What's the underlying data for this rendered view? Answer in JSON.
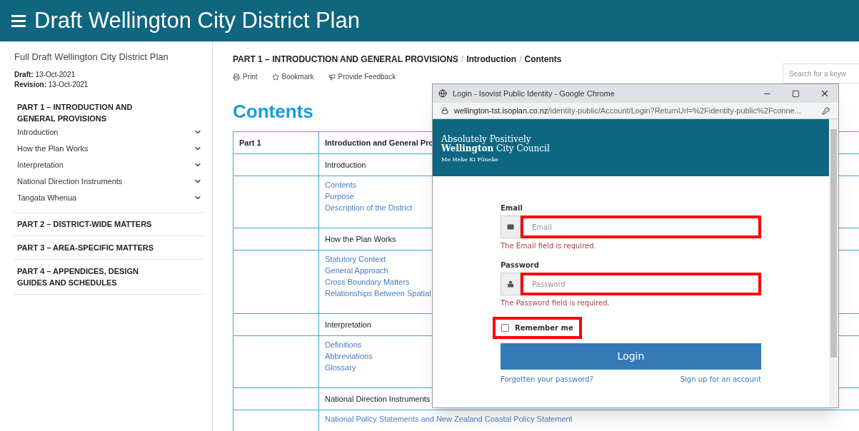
{
  "header": {
    "title": "Draft Wellington City District Plan"
  },
  "sidebar": {
    "title": "Full Draft Wellington City District Plan",
    "meta": [
      {
        "label": "Draft:",
        "value": "13-Oct-2021"
      },
      {
        "label": "Revision:",
        "value": "13-Oct-2021"
      }
    ],
    "parts": [
      {
        "label": "PART 1 – INTRODUCTION AND GENERAL PROVISIONS",
        "children": [
          {
            "label": "Introduction"
          },
          {
            "label": "How the Plan Works"
          },
          {
            "label": "Interpretation"
          },
          {
            "label": "National Direction Instruments"
          },
          {
            "label": "Tangata Whenua"
          }
        ]
      },
      {
        "label": "PART 2 – DISTRICT-WIDE MATTERS"
      },
      {
        "label": "PART 3 – AREA-SPECIFIC MATTERS"
      },
      {
        "label": "PART 4 – APPENDICES, DESIGN GUIDES AND SCHEDULES"
      }
    ]
  },
  "breadcrumb": [
    {
      "kind": "link",
      "label": "PART 1 – INTRODUCTION AND GENERAL PROVISIONS"
    },
    {
      "kind": "separator",
      "label": "/"
    },
    {
      "kind": "link",
      "label": "Introduction"
    },
    {
      "kind": "separator",
      "label": "/"
    },
    {
      "kind": "link",
      "label": "Contents"
    }
  ],
  "actions": [
    {
      "kind": "print",
      "label": "Print"
    },
    {
      "kind": "bookmark",
      "label": "Bookmark"
    },
    {
      "kind": "feedback",
      "label": "Provide Feedback"
    }
  ],
  "search": {
    "placeholder": "Search for a keyw"
  },
  "heading": "Contents",
  "table": {
    "rows": [
      {
        "kind": "heading",
        "column_1": "Part 1",
        "column_2": [
          "Introduction and General Pro"
        ]
      },
      {
        "kind": "section",
        "column_2": [
          "Introduction"
        ]
      },
      {
        "kind": "links",
        "column_2": [
          "Contents",
          "Purpose",
          "Description of the District"
        ]
      },
      {
        "kind": "section",
        "column_2": [
          "How the Plan Works"
        ]
      },
      {
        "kind": "links",
        "column_2": [
          "Statutory Context",
          "General Approach",
          "Cross Boundary Matters",
          "Relationships Between Spatial"
        ]
      },
      {
        "kind": "section",
        "column_2": [
          "Interpretation"
        ]
      },
      {
        "kind": "links",
        "column_2": [
          "Definitions",
          "Abbreviations",
          "Glossary"
        ]
      },
      {
        "kind": "section",
        "column_2": [
          "National Direction Instruments"
        ]
      },
      {
        "kind": "links",
        "column_2": [
          "National Policy Statements and New Zealand Coastal Policy Statement"
        ]
      }
    ]
  },
  "popup": {
    "title": "Login - Isovist Public Identity - Google Chrome",
    "url_host": "wellington-tst.isoplan.co.nz",
    "url_path": "/identity-public/Account/Login?ReturnUrl=%2Fidentity-public%2Fconne...",
    "logo": {
      "line_1": "Absolutely Positively",
      "line_2_bold": "Wellington",
      "line_2": "City Council",
      "tagline": "Me Heke Ki Pōneke"
    },
    "fields": [
      {
        "kind": "email",
        "label": "Email",
        "placeholder": "Email",
        "error": "The Email field is required.",
        "highlighted": true
      },
      {
        "kind": "password",
        "label": "Password",
        "placeholder": "Password",
        "error": "The Password field is required.",
        "highlighted": true
      }
    ],
    "remember": {
      "label": "Remember me",
      "checked": false,
      "highlighted": true
    },
    "button": "Login",
    "links": [
      "Forgotten your password?",
      "Sign up for an account"
    ]
  }
}
